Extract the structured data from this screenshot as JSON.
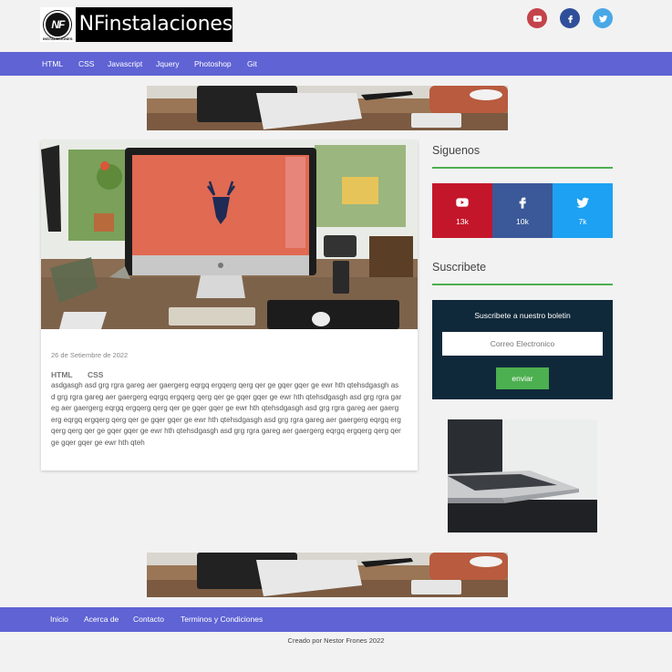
{
  "brand": {
    "name": "NFinstalaciones",
    "mark": "NF",
    "mark_caption": "INSTALACIONES"
  },
  "header_social": [
    {
      "icon": "youtube-icon",
      "color": "#c4434a"
    },
    {
      "icon": "facebook-icon",
      "color": "#2f4f9a"
    },
    {
      "icon": "twitter-icon",
      "color": "#49a8e6"
    }
  ],
  "nav": {
    "items": [
      "HTML",
      "CSS",
      "Javascript",
      "Jquery",
      "Photoshop",
      "Git"
    ]
  },
  "post": {
    "date": "26 de Setiembre de 2022",
    "tags": [
      "HTML",
      "CSS"
    ],
    "body": "asdgasgh asd grg rgra gareg aer gaergerg eqrgq ergqerg qerg qer ge gqer gqer ge ewr hth qtehsdgasgh asd grg rgra gareg aer gaergerg eqrgq ergqerg qerg qer ge gqer gqer ge ewr hth qtehsdgasgh asd grg rgra gareg aer gaergerg eqrgq ergqerg qerg qer ge gqer gqer ge ewr hth qtehsdgasgh asd grg rgra gareg aer gaergerg eqrgq ergqerg qerg qer ge gqer gqer ge ewr hth qtehsdgasgh asd grg rgra gareg aer gaergerg eqrgq ergqerg qerg qer ge gqer gqer ge ewr hth qtehsdgasgh asd grg rgra gareg aer gaergerg eqrgq ergqerg qerg qer ge gqer gqer ge ewr hth qteh"
  },
  "sidebar": {
    "follow_title": "Siguenos",
    "social": [
      {
        "icon": "youtube-icon",
        "count": "13k",
        "color": "#c4162a"
      },
      {
        "icon": "facebook-icon",
        "count": "10k",
        "color": "#3b5998"
      },
      {
        "icon": "twitter-icon",
        "count": "7k",
        "color": "#1da1f2"
      }
    ],
    "subscribe_title": "Suscribete",
    "newsletter": {
      "title": "Suscribete a nuestro boletin",
      "placeholder": "Correo Electronico",
      "button": "enviar"
    }
  },
  "footer": {
    "items": [
      "Inicio",
      "Acerca de",
      "Contacto",
      "Terminos y Condiciones"
    ],
    "credit": "Creado por Nestor Frones 2022"
  },
  "colors": {
    "nav": "#5f63d4",
    "accent_green": "#4caf50",
    "newsletter_bg": "#10293a"
  }
}
